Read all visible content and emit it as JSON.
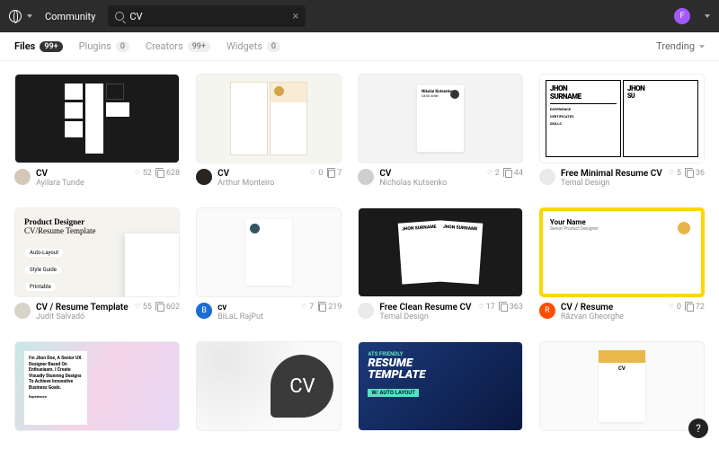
{
  "topbar": {
    "section": "Community",
    "search_value": "CV",
    "avatar_initial": "F"
  },
  "tabs": [
    {
      "label": "Files",
      "count": "99+",
      "active": true
    },
    {
      "label": "Plugins",
      "count": "0",
      "active": false
    },
    {
      "label": "Creators",
      "count": "99+",
      "active": false
    },
    {
      "label": "Widgets",
      "count": "0",
      "active": false
    }
  ],
  "sort_label": "Trending",
  "cards": [
    {
      "title": "CV",
      "author": "Ayilara Tunde",
      "likes": "52",
      "dupes": "628",
      "avatar_bg": "#d4c9b8"
    },
    {
      "title": "CV",
      "author": "Arthur Monteiro",
      "likes": "0",
      "dupes": "7",
      "avatar_bg": "#2a2420"
    },
    {
      "title": "CV",
      "author": "Nicholas Kutsenko",
      "likes": "2",
      "dupes": "44",
      "avatar_bg": "#cfcfcf"
    },
    {
      "title": "Free Minimal Resume CV",
      "author": "Temal Design",
      "likes": "5",
      "dupes": "36",
      "avatar_bg": "#eaeaea"
    },
    {
      "title": "CV / Resume Template",
      "author": "Judit Salvadó",
      "likes": "55",
      "dupes": "602",
      "avatar_bg": "#d8d4c8"
    },
    {
      "title": "cv",
      "author": "BiLaL RajPut",
      "likes": "7",
      "dupes": "219",
      "avatar_bg": "#1a6dd4",
      "avatar_initial": "B"
    },
    {
      "title": "Free Clean Resume CV",
      "author": "Temal Design",
      "likes": "17",
      "dupes": "363",
      "avatar_bg": "#eaeaea"
    },
    {
      "title": "CV / Resume",
      "author": "Răzvan Gheorghe",
      "likes": "0",
      "dupes": "72",
      "avatar_bg": "#ff4d00",
      "avatar_initial": "R"
    }
  ],
  "partial_row_count": 4,
  "thumb_text": {
    "jhon": "JHON",
    "surname": "SURNAME",
    "jhon_surname": "JHON SURNAME",
    "exp": "EXPERIENCE",
    "cert": "CERTIFICATES",
    "skills": "SKILLS",
    "nk_name": "Nikolai Kutsenko",
    "nk_role": "UX/UI Artist",
    "t4_h1": "Product Designer",
    "t4_h2": "CV/Resume Template",
    "t4_tag1": "Auto-Layout",
    "t4_tag2": "Style Guide",
    "t4_tag3": "Printable",
    "t7_name": "Your Name",
    "t7_role": "Senior Product Designer",
    "t8_line": "I'm Jhon Doe, A Senior UX Designer Based On Enthusiasm. I Create Visually Stunning Designs To Achieve Innovative Business Goals.",
    "t8_exp": "Experience",
    "t9_cv": "CV",
    "t10_top": "ATS FRIENDLY",
    "t10_main1": "RESUME",
    "t10_main2": "TEMPLATE",
    "t10_badge": "W/ AUTO LAYOUT",
    "t11_cv": "CV"
  }
}
